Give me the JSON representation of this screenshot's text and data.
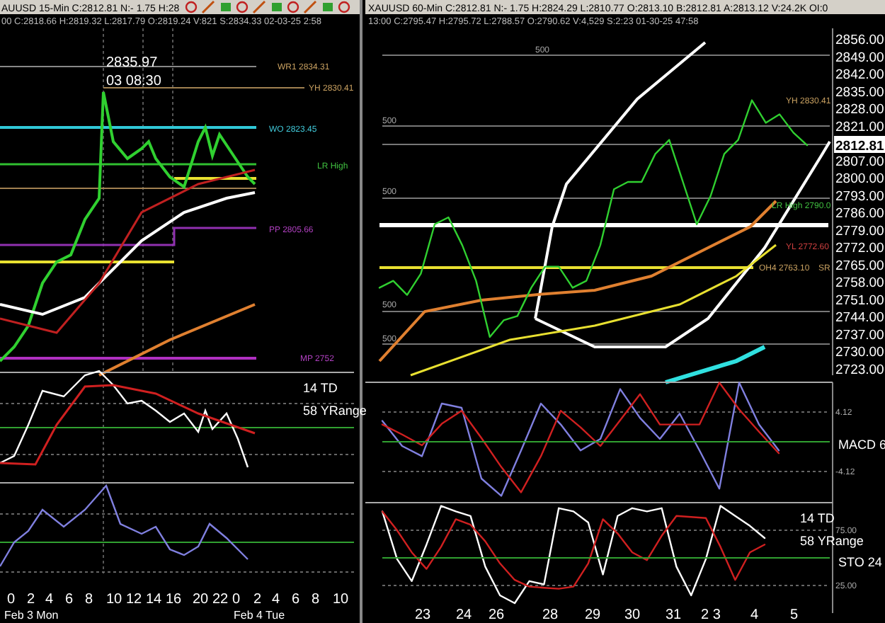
{
  "left_chart": {
    "header": "AUUSD 15-Min C:2812.81 N:- 1.75 H:28",
    "info": "00 C:2818.66 H:2819.32 L:2817.79 O:2819.24 V:821 S:2834.33 02-03-25 2:58",
    "annotation_price": "2835.97",
    "annotation_time": "03 08:30",
    "level_labels": [
      "WR1 2834.31",
      "YH 2830.41",
      "WO 2823.45",
      "LR High",
      "PP 2805.66",
      "MP 2752"
    ],
    "oscillator_labels": [
      "14 TD",
      "58 YRange"
    ],
    "x_labels": [
      "0",
      "2",
      "4",
      "6",
      "8",
      "10",
      "12",
      "14",
      "16",
      "20",
      "22",
      "0",
      "2",
      "4",
      "6",
      "8",
      "10"
    ],
    "date_labels": [
      "Feb 3 Mon",
      "Feb 4 Tue"
    ]
  },
  "right_chart": {
    "header": "XAUUSD 60-Min C:2812.81 N:- 1.75 H:2824.29 L:2810.77 O:2813.10 B:2812.81 A:2813.12 V:24.2K OI:0",
    "info": "13:00 C:2795.47 H:2795.72 L:2788.57 O:2790.62 V:4,529 S:2:23 01-30-25 47:58",
    "level_labels": [
      "500",
      "500",
      "500",
      "500",
      "500",
      "YH 2830.41",
      "LR High 2790.0",
      "YL 2772.60",
      "OH4 2763.10",
      "SR"
    ],
    "chart_data": {
      "type": "line",
      "ylim": [
        2720,
        2860
      ],
      "yticks": [
        {
          "value": 2856,
          "label": "2856.00"
        },
        {
          "value": 2849,
          "label": "2849.00"
        },
        {
          "value": 2842,
          "label": "2842.00"
        },
        {
          "value": 2835,
          "label": "2835.00"
        },
        {
          "value": 2828,
          "label": "2828.00"
        },
        {
          "value": 2821,
          "label": "2821.00"
        },
        {
          "value": 2807,
          "label": "2807.00"
        },
        {
          "value": 2800,
          "label": "2800.00"
        },
        {
          "value": 2793,
          "label": "2793.00"
        },
        {
          "value": 2786,
          "label": "2786.00"
        },
        {
          "value": 2779,
          "label": "2779.00"
        },
        {
          "value": 2772,
          "label": "2772.00"
        },
        {
          "value": 2765,
          "label": "2765.00"
        },
        {
          "value": 2758,
          "label": "2758.00"
        },
        {
          "value": 2751,
          "label": "2751.00"
        },
        {
          "value": 2744,
          "label": "2744.00"
        },
        {
          "value": 2737,
          "label": "2737.00"
        },
        {
          "value": 2730,
          "label": "2730.00"
        },
        {
          "value": 2723,
          "label": "2723.00"
        }
      ],
      "series": [
        {
          "color": "#30d030",
          "values": [
            2755.3,
            2758.1,
            2752.4,
            2761.0,
            2780.9,
            2783.7,
            2772.4,
            2758.1,
            2735.4,
            2742.2,
            2743.9,
            2755.3,
            2763.8,
            2763.8,
            2755.3,
            2758.1,
            2772.4,
            2795.1,
            2798.0,
            2798.0,
            2809.3,
            2815.0,
            2798.0,
            2780.9,
            2792.3,
            2809.3,
            2815.0,
            2831.0,
            2821.9,
            2825.3,
            2817.9,
            2812.8
          ]
        }
      ]
    },
    "last_price": "2812.81",
    "macd": {
      "label": "MACD 6",
      "chart_data": {
        "type": "line",
        "ylim": [
          -8.44,
          8.24
        ],
        "yticks": [
          {
            "value": 4.12,
            "label": "4.12"
          },
          {
            "value": -4.12,
            "label": "-4.12"
          }
        ],
        "series": [
          {
            "color": "#8080e0",
            "values": [
              2.9,
              -0.6,
              -2.0,
              5.3,
              4.7,
              -5.1,
              -7.5,
              -1.2,
              5.3,
              2.4,
              -1.2,
              0.4,
              7.3,
              3.3,
              0.4,
              3.9,
              -1.2,
              -6.5,
              8.2,
              2.4,
              -1.2
            ]
          },
          {
            "color": "#d02020",
            "values": [
              2.4,
              1.0,
              -0.5,
              2.5,
              4.3,
              0.5,
              -3.5,
              -7.0,
              -2.0,
              4.3,
              2.0,
              -0.6,
              3.0,
              6.6,
              2.4,
              2.4,
              2.4,
              8.2,
              4.5,
              1.4,
              -1.6
            ]
          }
        ]
      }
    },
    "stochastic": {
      "labels": [
        "14 TD",
        "58 YRange",
        "STO  24"
      ],
      "chart_data": {
        "type": "line",
        "ylim": [
          0,
          100
        ],
        "yticks": [
          {
            "value": 75,
            "label": "75.00"
          },
          {
            "value": 25,
            "label": "25.00"
          }
        ],
        "series": [
          {
            "color": "#ffffff",
            "values": [
              92,
              49,
              29,
              62,
              97,
              92,
              88,
              42,
              16,
              9,
              29,
              26,
              95,
              92,
              82,
              35,
              88,
              95,
              92,
              95,
              42,
              16,
              49,
              97,
              88,
              79,
              68
            ]
          },
          {
            "color": "#d02020",
            "values": [
              92,
              75,
              55,
              40,
              60,
              85,
              80,
              65,
              45,
              30,
              24,
              23,
              22,
              24,
              45,
              85,
              72,
              55,
              48,
              70,
              88,
              87,
              86,
              60,
              30,
              55,
              62
            ]
          }
        ]
      }
    },
    "x_labels": [
      "23",
      "24",
      "26",
      "28",
      "29",
      "30",
      "31",
      "2 3",
      "4",
      "5"
    ]
  }
}
